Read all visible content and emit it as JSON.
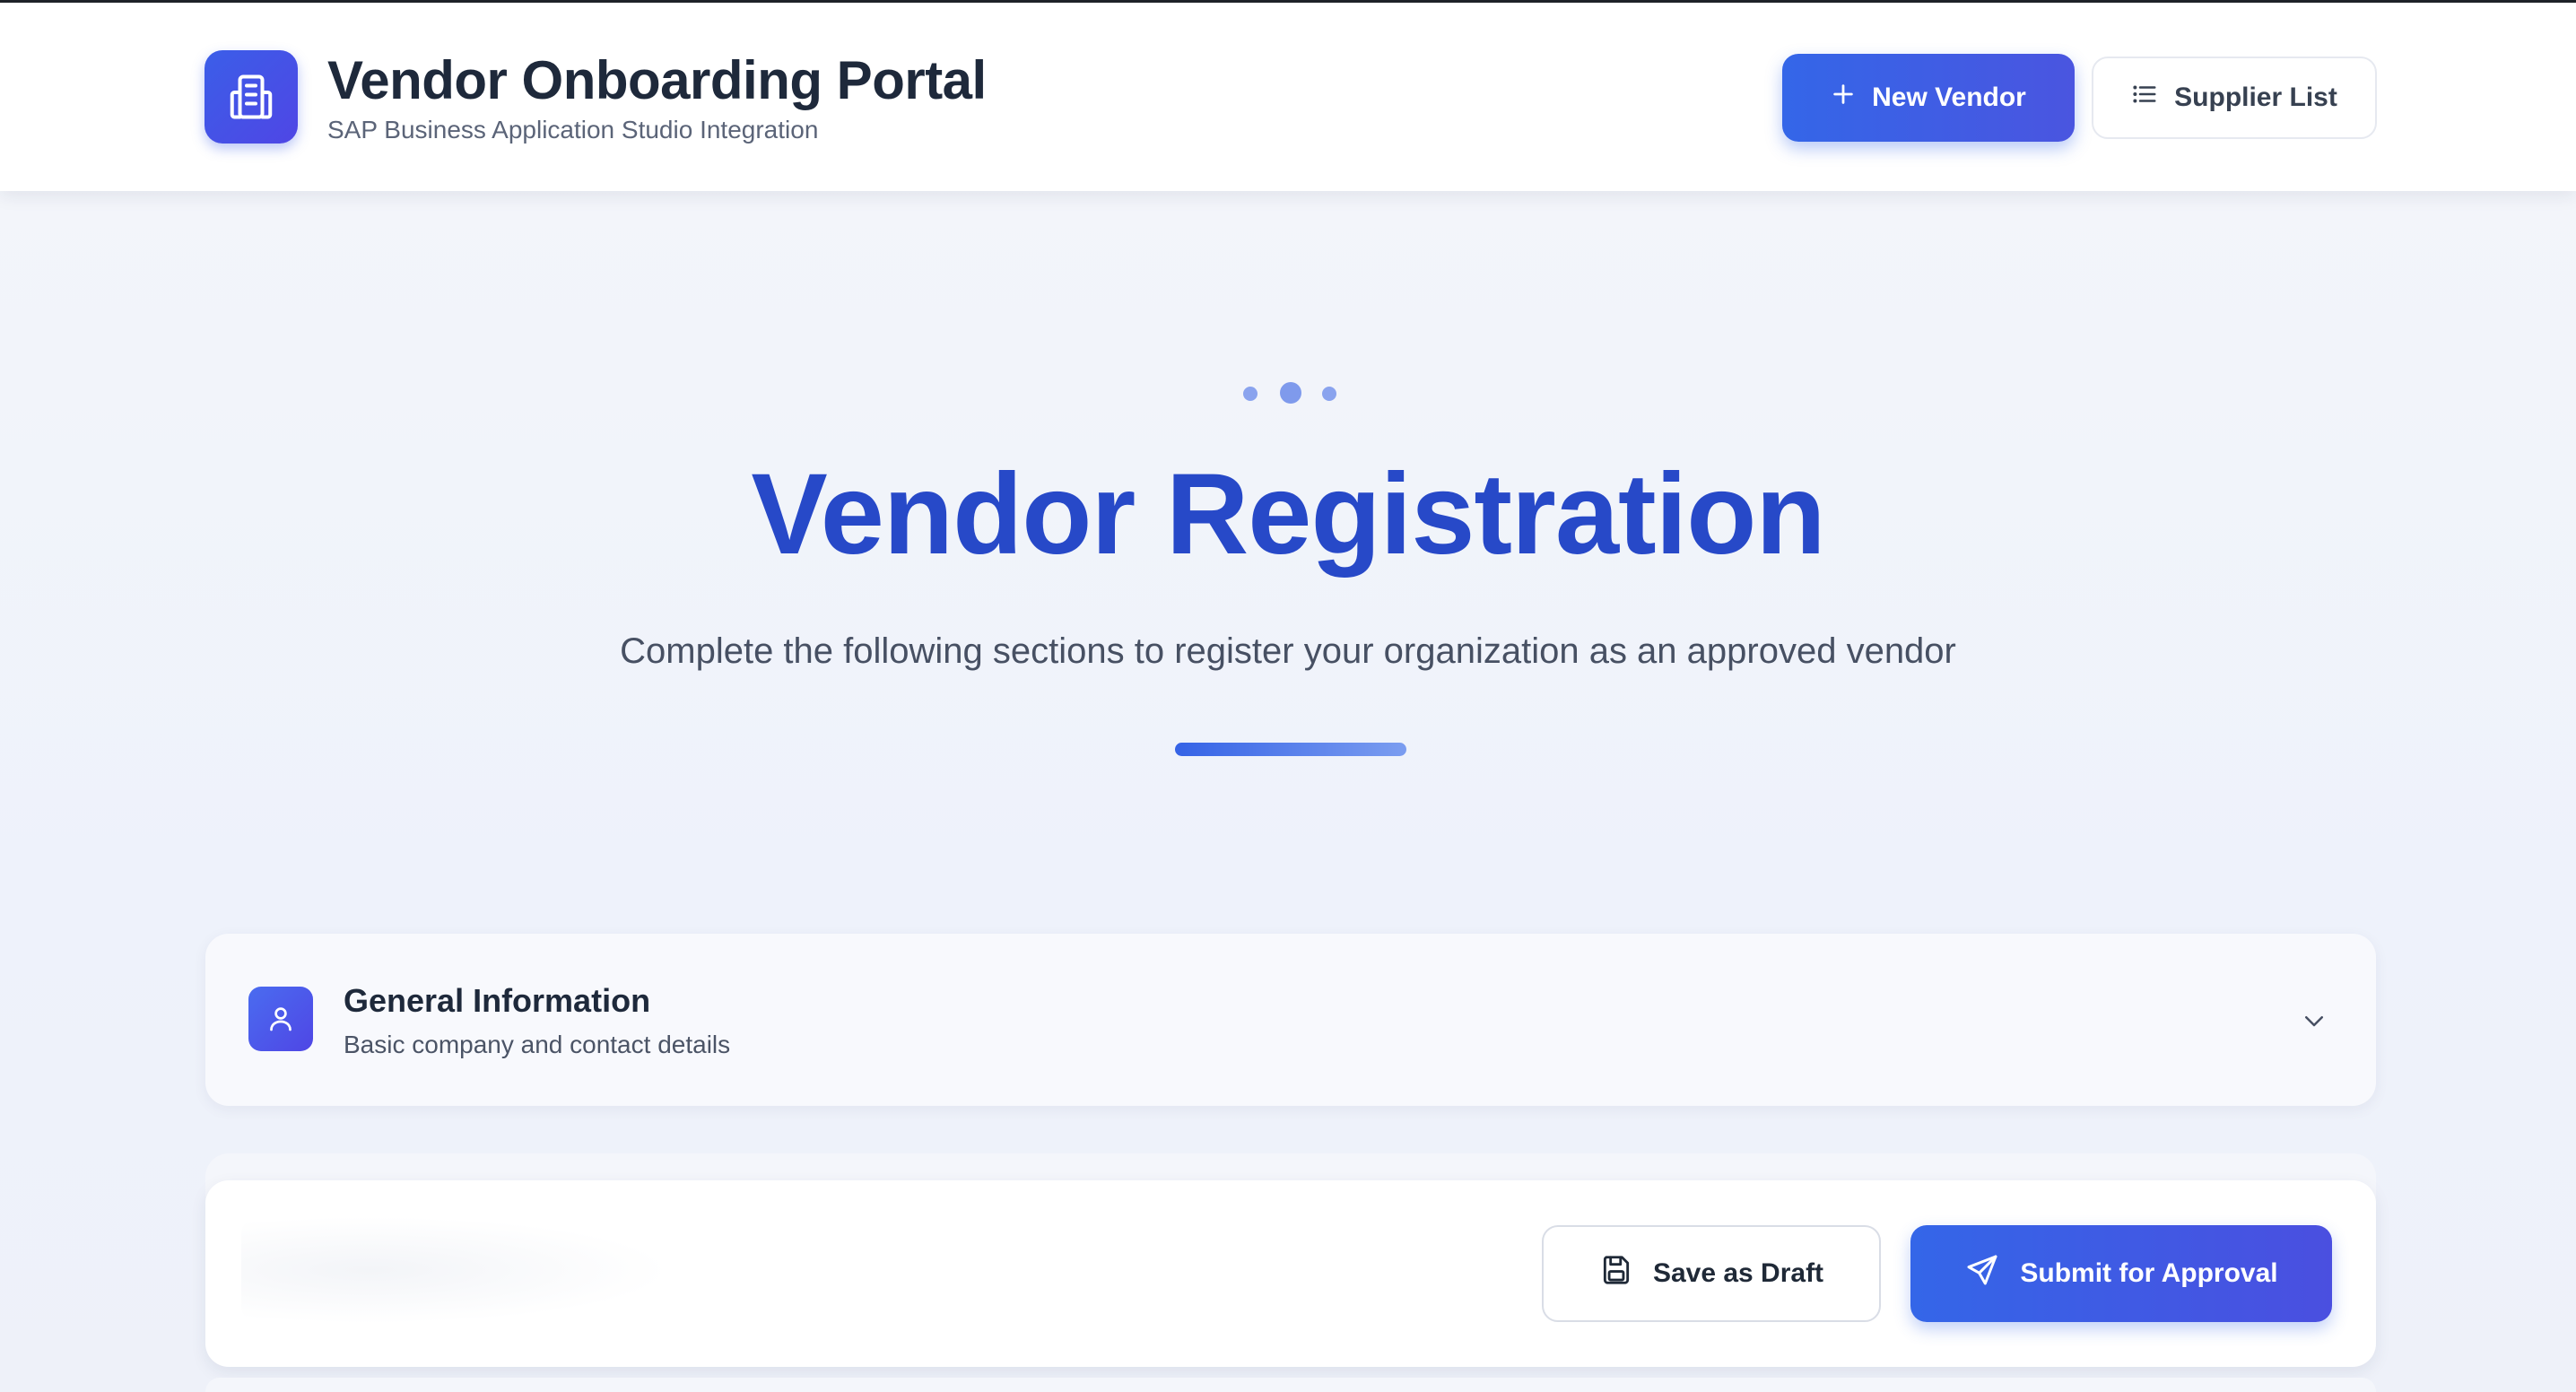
{
  "header": {
    "title": "Vendor Onboarding Portal",
    "subtitle": "SAP Business Application Studio Integration",
    "new_vendor_label": "New Vendor",
    "supplier_list_label": "Supplier List"
  },
  "hero": {
    "title": "Vendor Registration",
    "subtitle": "Complete the following sections to register your organization as an approved vendor"
  },
  "sections": [
    {
      "title": "General Information",
      "description": "Basic company and contact details",
      "icon": "user-icon",
      "expanded": false
    }
  ],
  "actions": {
    "save_draft_label": "Save as Draft",
    "submit_label": "Submit for Approval"
  },
  "colors": {
    "primary": "#3466e8",
    "hero_title": "#2749c8",
    "indigo": "#4f46e5"
  }
}
